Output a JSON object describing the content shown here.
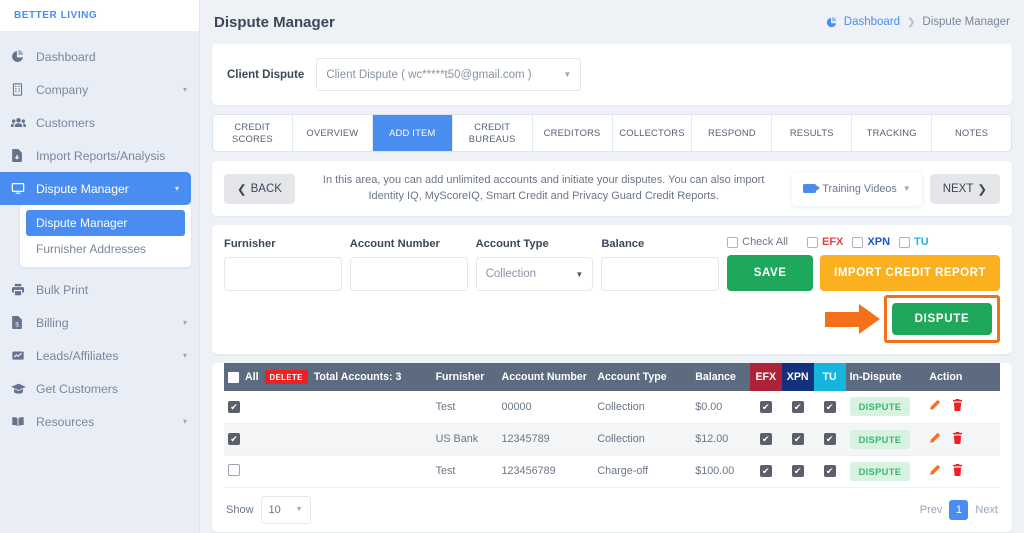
{
  "brand": {
    "name": "BETTER LIVING"
  },
  "sidebar": {
    "items": [
      {
        "label": "Dashboard",
        "icon": "pie-chart-icon",
        "caret": "",
        "active": false
      },
      {
        "label": "Company",
        "icon": "building-icon",
        "caret": "▾",
        "active": false
      },
      {
        "label": "Customers",
        "icon": "users-icon",
        "caret": "",
        "active": false
      },
      {
        "label": "Import Reports/Analysis",
        "icon": "file-import-icon",
        "caret": "",
        "active": false
      },
      {
        "label": "Dispute Manager",
        "icon": "monitor-icon",
        "caret": "▾",
        "active": true
      },
      {
        "label": "Bulk Print",
        "icon": "printer-icon",
        "caret": "",
        "active": false
      },
      {
        "label": "Billing",
        "icon": "invoice-icon",
        "caret": "▾",
        "active": false
      },
      {
        "label": "Leads/Affiliates",
        "icon": "chart-line-icon",
        "caret": "▾",
        "active": false
      },
      {
        "label": "Get Customers",
        "icon": "graduation-icon",
        "caret": "",
        "active": false
      },
      {
        "label": "Resources",
        "icon": "book-icon",
        "caret": "▾",
        "active": false
      }
    ],
    "submenu": [
      {
        "label": "Dispute Manager",
        "active": true
      },
      {
        "label": "Furnisher Addresses",
        "active": false
      }
    ]
  },
  "header": {
    "title": "Dispute Manager",
    "breadcrumb_home": "Dashboard",
    "breadcrumb_sep": "❯",
    "breadcrumb_current": "Dispute Manager"
  },
  "client": {
    "label": "Client Dispute",
    "selected": "Client Dispute ( wc*****t50@gmail.com )"
  },
  "tabs": [
    {
      "label": "CREDIT SCORES",
      "active": false
    },
    {
      "label": "OVERVIEW",
      "active": false
    },
    {
      "label": "ADD ITEM",
      "active": true
    },
    {
      "label": "CREDIT BUREAUS",
      "active": false
    },
    {
      "label": "CREDITORS",
      "active": false
    },
    {
      "label": "COLLECTORS",
      "active": false
    },
    {
      "label": "RESPOND",
      "active": false
    },
    {
      "label": "RESULTS",
      "active": false
    },
    {
      "label": "TRACKING",
      "active": false
    },
    {
      "label": "NOTES",
      "active": false
    }
  ],
  "instructions": {
    "back_label": "BACK",
    "next_label": "NEXT",
    "text": "In this area, you can add unlimited accounts and initiate your disputes. You can also import Identity IQ, MyScoreIQ, Smart Credit and Privacy Guard Credit Reports.",
    "training_videos_label": "Training Videos"
  },
  "form": {
    "furnisher_label": "Furnisher",
    "furnisher_value": "",
    "account_number_label": "Account Number",
    "account_number_value": "",
    "account_type_label": "Account Type",
    "account_type_value": "Collection",
    "balance_label": "Balance",
    "balance_value": "",
    "check_all_label": "Check All",
    "efx_label": "EFX",
    "xpn_label": "XPN",
    "tu_label": "TU",
    "save_label": "SAVE",
    "import_label": "IMPORT CREDIT REPORT",
    "dispute_label": "DISPUTE"
  },
  "table": {
    "select_all_label": "All",
    "delete_label": "DELETE",
    "total_label": "Total Accounts: 3",
    "columns": [
      "Furnisher",
      "Account Number",
      "Account Type",
      "Balance",
      "EFX",
      "XPN",
      "TU",
      "In-Dispute",
      "Action"
    ],
    "rows": [
      {
        "checked": true,
        "furnisher": "Test",
        "account_number": "00000",
        "account_type": "Collection",
        "balance": "$0.00",
        "efx": true,
        "xpn": true,
        "tu": true,
        "in_dispute": "DISPUTE"
      },
      {
        "checked": true,
        "furnisher": "US Bank",
        "account_number": "12345789",
        "account_type": "Collection",
        "balance": "$12.00",
        "efx": true,
        "xpn": true,
        "tu": true,
        "in_dispute": "DISPUTE"
      },
      {
        "checked": false,
        "furnisher": "Test",
        "account_number": "123456789",
        "account_type": "Charge-off",
        "balance": "$100.00",
        "efx": true,
        "xpn": true,
        "tu": true,
        "in_dispute": "DISPUTE"
      }
    ]
  },
  "footer": {
    "show_label": "Show",
    "show_value": "10",
    "prev_label": "Prev",
    "page_number": "1",
    "next_label": "Next"
  },
  "colors": {
    "primary": "#4a8df0",
    "green": "#1fa85c",
    "orange": "#fbb01f",
    "highlight_orange": "#f4701b",
    "efx_red": "#ab2239",
    "xpn_navy": "#14307e",
    "tu_cyan": "#17b4dd",
    "header_slate": "#5d6b80",
    "delete_red": "#ed2024"
  }
}
